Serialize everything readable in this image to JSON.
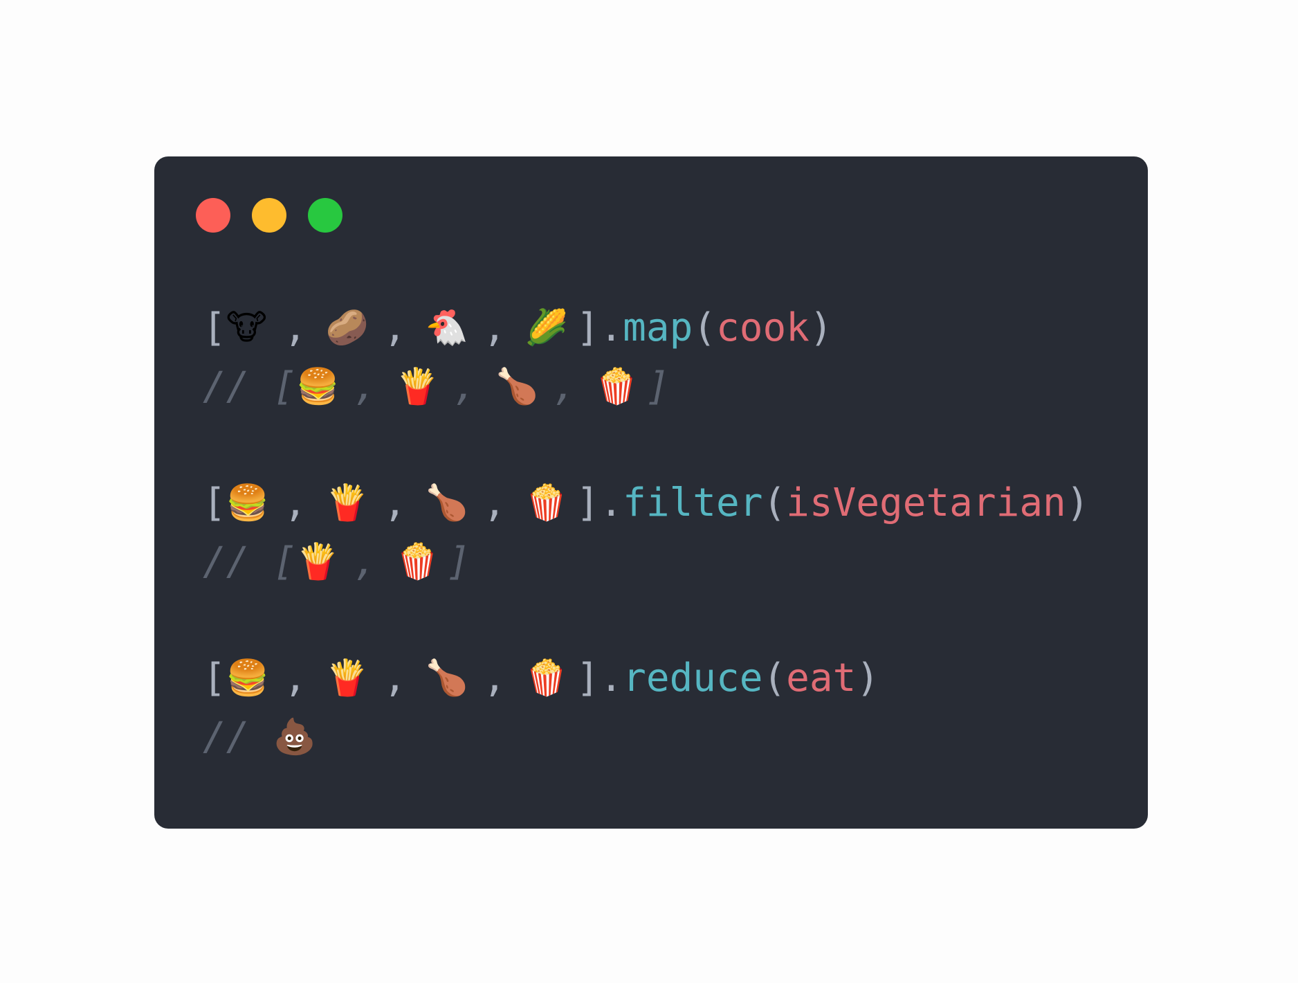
{
  "window": {
    "controls": [
      "close",
      "minimize",
      "maximize"
    ],
    "colors": {
      "background": "#282c35",
      "close": "#fd5f57",
      "minimize": "#febc2e",
      "maximize": "#28c840"
    }
  },
  "code": {
    "open_bracket": "[",
    "close_bracket": "]",
    "separator": ",",
    "dot": ".",
    "paren_open": "(",
    "paren_close": ")",
    "comment_prefix": "//",
    "line1": {
      "items": [
        "🐮",
        "🥔",
        "🐔",
        "🌽"
      ],
      "method": "map",
      "arg": "cook"
    },
    "comment1": {
      "items": [
        "🍔",
        "🍟",
        "🍗",
        "🍿"
      ]
    },
    "line2": {
      "items": [
        "🍔",
        "🍟",
        "🍗",
        "🍿"
      ],
      "method": "filter",
      "arg": "isVegetarian"
    },
    "comment2": {
      "items": [
        "🍟",
        "🍿"
      ]
    },
    "line3": {
      "items": [
        "🍔",
        "🍟",
        "🍗",
        "🍿"
      ],
      "method": "reduce",
      "arg": "eat"
    },
    "comment3": {
      "result": "💩"
    }
  }
}
